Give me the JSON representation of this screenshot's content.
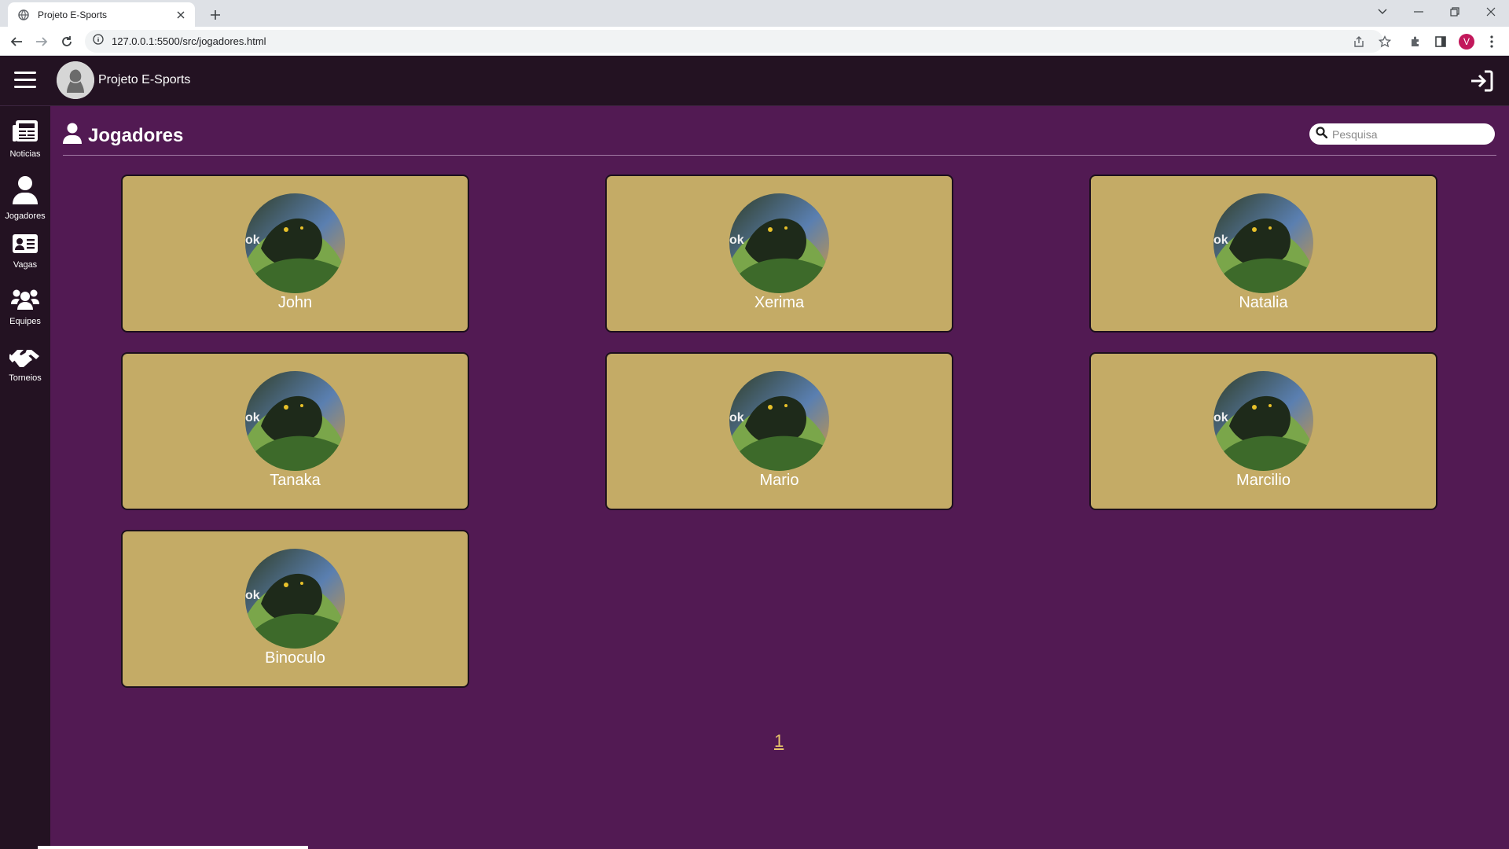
{
  "browser": {
    "tab_title": "Projeto E-Sports",
    "url": "127.0.0.1:5500/src/jogadores.html",
    "profile_initial": "V"
  },
  "header": {
    "brand_name": "Projeto E-Sports"
  },
  "sidebar": {
    "items": [
      {
        "label": "Noticias",
        "icon": "newspaper-icon"
      },
      {
        "label": "Jogadores",
        "icon": "user-icon"
      },
      {
        "label": "Vagas",
        "icon": "id-card-icon"
      },
      {
        "label": "Equipes",
        "icon": "users-icon"
      },
      {
        "label": "Torneios",
        "icon": "handshake-icon"
      }
    ]
  },
  "main": {
    "title": "Jogadores",
    "search_placeholder": "Pesquisa",
    "players": [
      {
        "name": "John"
      },
      {
        "name": "Xerima"
      },
      {
        "name": "Natalia"
      },
      {
        "name": "Tanaka"
      },
      {
        "name": "Mario"
      },
      {
        "name": "Marcilio"
      },
      {
        "name": "Binoculo"
      }
    ],
    "pagination": {
      "current_page": "1"
    }
  },
  "colors": {
    "page_bg": "#521a53",
    "header_bg": "#231222",
    "card_bg": "#c4ab66",
    "pager_link": "#e8c56b"
  }
}
